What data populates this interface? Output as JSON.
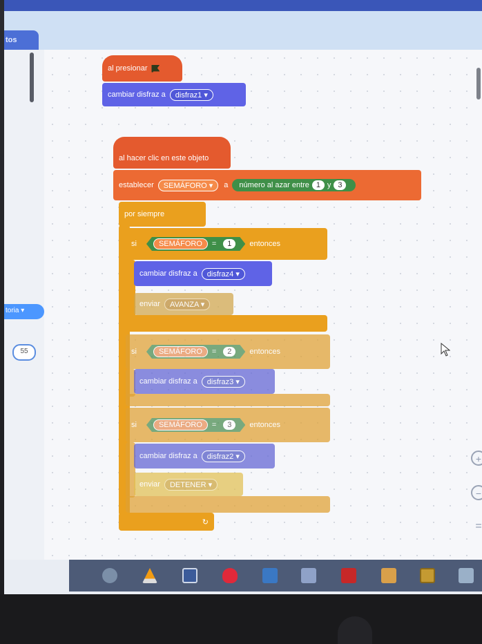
{
  "editor": {
    "tab_partial_label": "tos",
    "palette_dropdown_partial": "toria",
    "palette_count": "55"
  },
  "script1": {
    "hat_label": "al presionar",
    "costume_label": "cambiar disfraz a",
    "costume_value": "disfraz1"
  },
  "script2": {
    "hat_label": "al hacer clic en este objeto",
    "set_label": "establecer",
    "set_variable": "SEMÁFORO",
    "set_to": "a",
    "random_label": "número al azar entre",
    "random_min": "1",
    "random_and": "y",
    "random_max": "3",
    "forever_label": "por siempre",
    "if_blocks": [
      {
        "if_label": "si",
        "variable": "SEMÁFORO",
        "op": "=",
        "value": "1",
        "then_label": "entonces",
        "costume_label": "cambiar disfraz a",
        "costume_value": "disfraz4",
        "broadcast_label": "enviar",
        "broadcast_value": "AVANZA"
      },
      {
        "if_label": "si",
        "variable": "SEMÁFORO",
        "op": "=",
        "value": "2",
        "then_label": "entonces",
        "costume_label": "cambiar disfraz a",
        "costume_value": "disfraz3"
      },
      {
        "if_label": "si",
        "variable": "SEMÁFORO",
        "op": "=",
        "value": "3",
        "then_label": "entonces",
        "costume_label": "cambiar disfraz a",
        "costume_value": "disfraz2",
        "broadcast_label": "enviar",
        "broadcast_value": "DETENER"
      }
    ]
  },
  "colors": {
    "events": "#e45a2e",
    "looks": "#5f63e6",
    "control": "#eaa01e",
    "variables": "#ec6a33",
    "operators": "#4a9d4e"
  },
  "taskbar": {
    "icons": [
      "paint-icon",
      "vlc-icon",
      "photo-frame-icon",
      "heart-icon",
      "calculator-icon",
      "screen-icon",
      "pdf-icon",
      "map-icon",
      "book-icon",
      "network-icon"
    ]
  }
}
